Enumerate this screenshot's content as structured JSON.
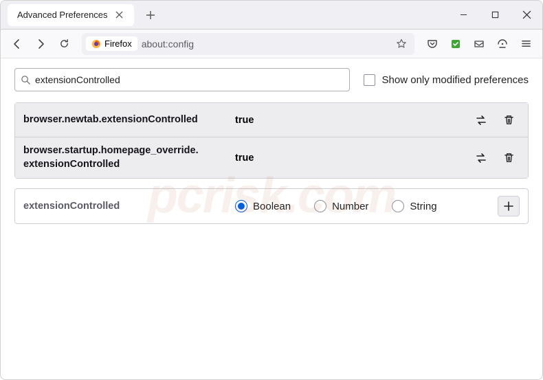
{
  "tab": {
    "title": "Advanced Preferences"
  },
  "urlbar": {
    "badge": "Firefox",
    "url": "about:config"
  },
  "search": {
    "value": "extensionControlled"
  },
  "checkbox": {
    "label": "Show only modified preferences"
  },
  "prefs": [
    {
      "name": "browser.newtab.extensionControlled",
      "value": "true"
    },
    {
      "name": "browser.startup.homepage_override.\nextensionControlled",
      "value": "true"
    }
  ],
  "newpref": {
    "name": "extensionControlled",
    "types": [
      {
        "label": "Boolean",
        "checked": true
      },
      {
        "label": "Number",
        "checked": false
      },
      {
        "label": "String",
        "checked": false
      }
    ]
  },
  "watermark": "pcrisk.com"
}
